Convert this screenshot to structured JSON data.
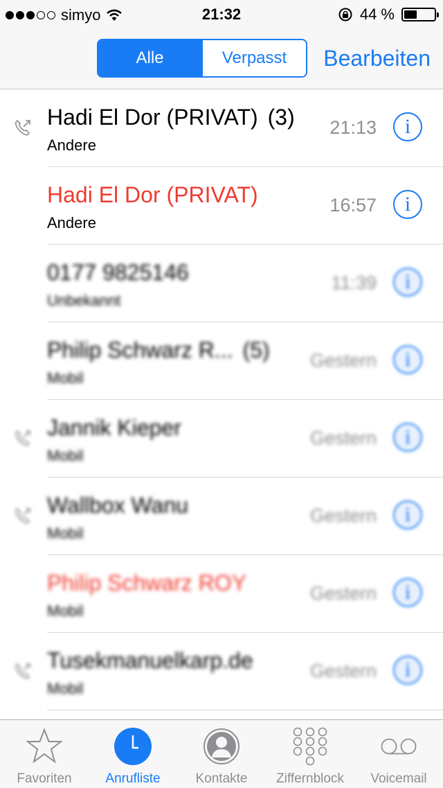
{
  "status_bar": {
    "carrier": "simyo",
    "time": "21:32",
    "battery_percent": 44,
    "battery_label": "44 %",
    "signal_full": 3,
    "signal_total": 5
  },
  "nav": {
    "segment_all": "Alle",
    "segment_missed": "Verpasst",
    "edit_label": "Bearbeiten"
  },
  "calls": [
    {
      "name": "Hadi El Dor (PRIVAT)",
      "count": "(3)",
      "type": "Andere",
      "time": "21:13",
      "missed": false,
      "outgoing": true,
      "blurred": false
    },
    {
      "name": "Hadi El Dor (PRIVAT)",
      "count": "",
      "type": "Andere",
      "time": "16:57",
      "missed": true,
      "outgoing": false,
      "blurred": false
    },
    {
      "name": "0177 9825146",
      "count": "",
      "type": "Unbekannt",
      "time": "11:39",
      "missed": false,
      "outgoing": false,
      "blurred": true
    },
    {
      "name": "Philip Schwarz R...",
      "count": "(5)",
      "type": "Mobil",
      "time": "Gestern",
      "missed": false,
      "outgoing": false,
      "blurred": true
    },
    {
      "name": "Jannik Kieper",
      "count": "",
      "type": "Mobil",
      "time": "Gestern",
      "missed": false,
      "outgoing": true,
      "blurred": true
    },
    {
      "name": "Wallbox Wanu",
      "count": "",
      "type": "Mobil",
      "time": "Gestern",
      "missed": false,
      "outgoing": true,
      "blurred": true
    },
    {
      "name": "Philip Schwarz ROY",
      "count": "",
      "type": "Mobil",
      "time": "Gestern",
      "missed": true,
      "outgoing": false,
      "blurred": true
    },
    {
      "name": "Tusekmanuelkarp.de",
      "count": "",
      "type": "Mobil",
      "time": "Gestern",
      "missed": false,
      "outgoing": true,
      "blurred": true
    }
  ],
  "tabs": [
    {
      "label": "Favoriten",
      "icon": "star-icon",
      "active": false
    },
    {
      "label": "Anrufliste",
      "icon": "clock-icon",
      "active": true
    },
    {
      "label": "Kontakte",
      "icon": "contact-icon",
      "active": false
    },
    {
      "label": "Ziffernblock",
      "icon": "keypad-icon",
      "active": false
    },
    {
      "label": "Voicemail",
      "icon": "voicemail-icon",
      "active": false
    }
  ],
  "colors": {
    "accent": "#1a7cf5",
    "missed": "#ee3b30",
    "secondary": "#8e8e93",
    "bar_bg": "#f7f7f7"
  }
}
